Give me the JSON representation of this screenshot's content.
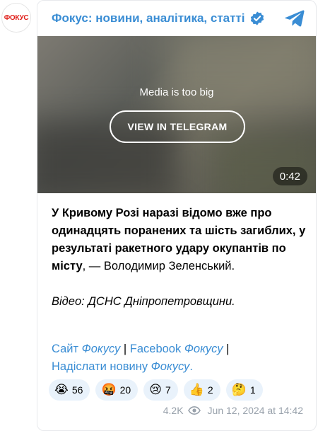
{
  "avatar": {
    "text": "ФОКУС"
  },
  "header": {
    "channel_name": "Фокус: новини, аналітика, статті"
  },
  "media": {
    "message": "Media is too big",
    "button_label": "VIEW IN TELEGRAM",
    "duration": "0:42"
  },
  "post": {
    "bold_text": "У Кривому Розі наразі відомо вже про одинадцять поранених та шість загиблих, у результаті ракетного удару окупантів по місту",
    "plain_text": ", — Володимир Зеленський.",
    "italic_text": "Відео: ДСНС Дніпропетровщини."
  },
  "links": {
    "site_prefix": "Сайт ",
    "site_italic": "Фокусу",
    "facebook_prefix": "Facebook ",
    "facebook_italic": "Фокусу",
    "send_prefix": "Надіслати новину ",
    "send_italic": "Фокусу",
    "send_suffix": ".",
    "separator": " | "
  },
  "reactions": [
    {
      "emoji": "😭",
      "count": "56"
    },
    {
      "emoji": "🤬",
      "count": "20"
    },
    {
      "emoji": "😢",
      "count": "7"
    },
    {
      "emoji": "👍",
      "count": "2"
    },
    {
      "emoji": "🤔",
      "count": "1"
    }
  ],
  "meta": {
    "views": "4.2K",
    "date": "Jun 12, 2024 at 14:42"
  },
  "colors": {
    "link": "#3a8dd4",
    "reaction_bg": "#e9f2fb",
    "meta": "#98a1ab"
  },
  "icons": {
    "verified": "verified-badge-icon",
    "telegram": "telegram-icon",
    "views": "eye-icon"
  }
}
